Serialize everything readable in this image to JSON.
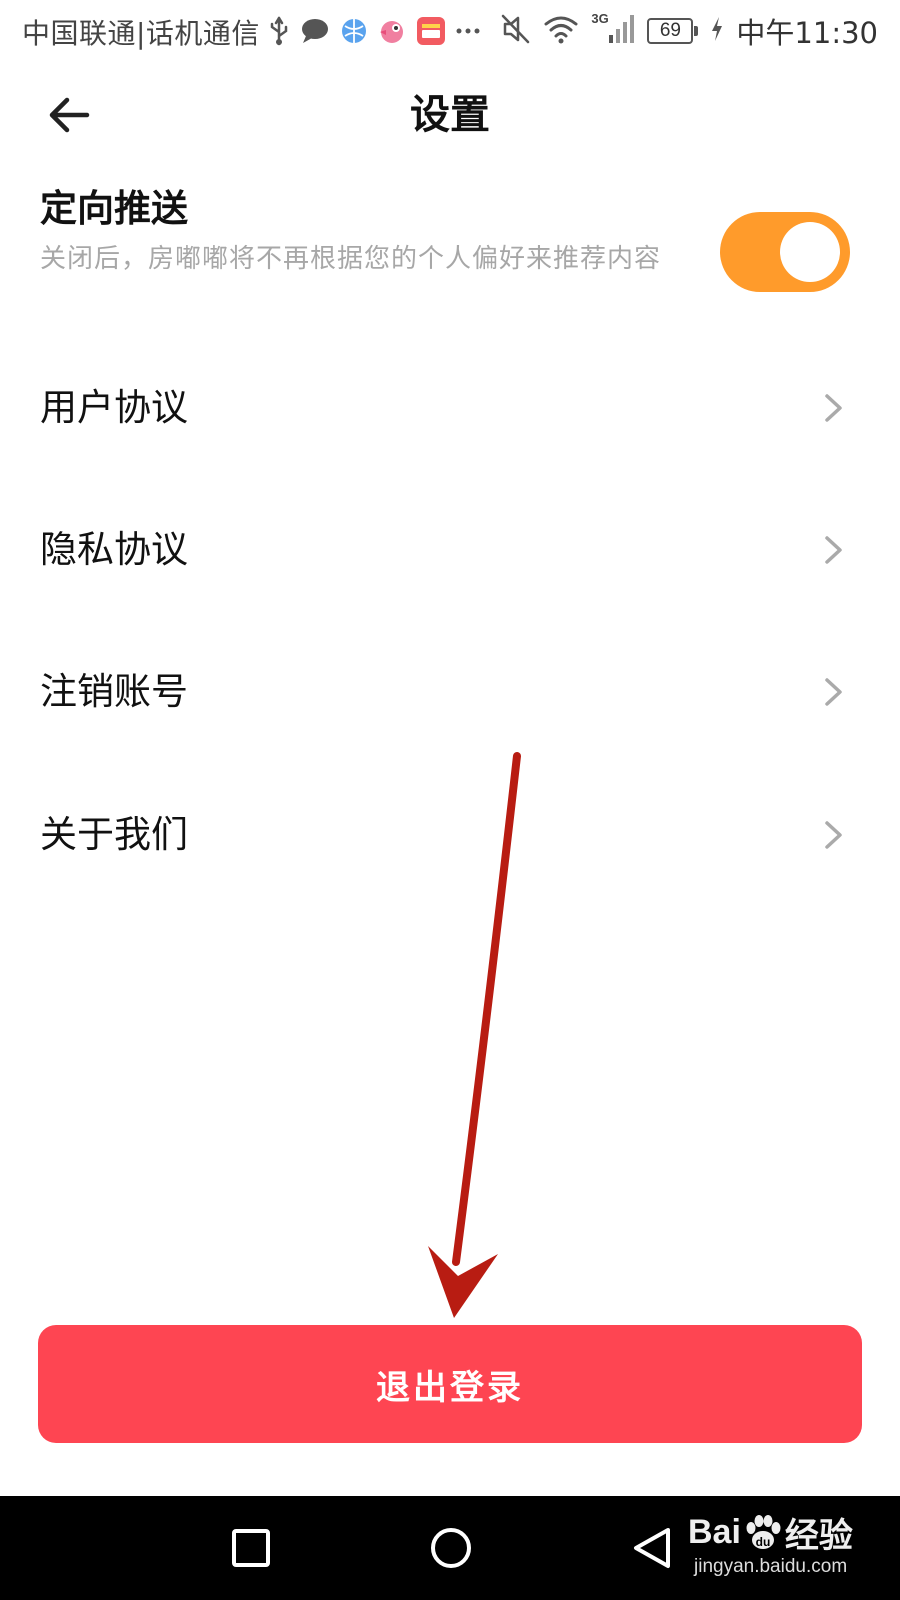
{
  "status_bar": {
    "carrier": "中国联通|话机通信",
    "battery": "69",
    "time": "中午11:30",
    "network": "3G",
    "notification_icons": [
      "usb-icon",
      "chat-bubble-icon",
      "browser-icon",
      "app-bird-icon",
      "wallet-icon",
      "more-dots-icon"
    ],
    "system_icons": [
      "mute-icon",
      "wifi-icon",
      "signal-icon",
      "battery-icon",
      "charging-icon"
    ]
  },
  "header": {
    "title": "设置",
    "back_icon": "arrow-left-icon"
  },
  "settings": {
    "targeted_push": {
      "title": "定向推送",
      "description": "关闭后，房嘟嘟将不再根据您的个人偏好来推荐内容",
      "enabled": true
    },
    "items": [
      {
        "label": "用户协议",
        "icon": "chevron-right-icon"
      },
      {
        "label": "隐私协议",
        "icon": "chevron-right-icon"
      },
      {
        "label": "注销账号",
        "icon": "chevron-right-icon"
      },
      {
        "label": "关于我们",
        "icon": "chevron-right-icon"
      }
    ]
  },
  "logout_label": "退出登录",
  "nav_bar": {
    "buttons": [
      "recent-apps-square-icon",
      "home-circle-icon",
      "back-triangle-icon"
    ]
  },
  "watermark": {
    "brand_prefix": "Bai",
    "brand_suffix": "经验",
    "url": "jingyan.baidu.com"
  },
  "colors": {
    "toggle_on": "#ff9b2b",
    "logout_button": "#fe4552",
    "annotation_arrow": "#b81c12",
    "nav_bar": "#000000"
  }
}
